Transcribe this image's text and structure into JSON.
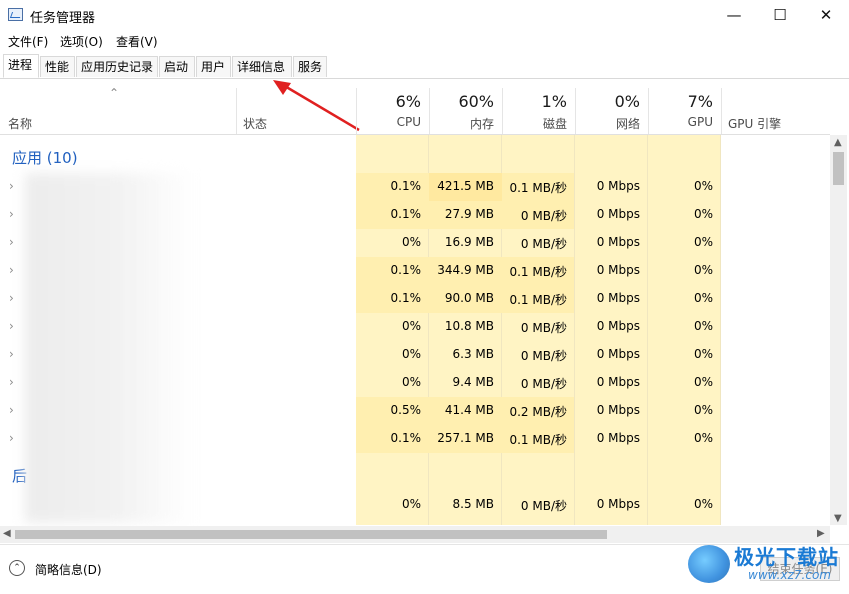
{
  "window": {
    "title": "任务管理器",
    "minimize": "—",
    "maximize": "☐",
    "close": "✕"
  },
  "menu": [
    "文件(F)",
    "选项(O)",
    "查看(V)"
  ],
  "tabs": [
    "进程",
    "性能",
    "应用历史记录",
    "启动",
    "用户",
    "详细信息",
    "服务"
  ],
  "columns": {
    "name": "名称",
    "status": "状态",
    "cpu": {
      "pct": "6%",
      "label": "CPU"
    },
    "memory": {
      "pct": "60%",
      "label": "内存"
    },
    "disk": {
      "pct": "1%",
      "label": "磁盘"
    },
    "network": {
      "pct": "0%",
      "label": "网络"
    },
    "gpu": {
      "pct": "7%",
      "label": "GPU"
    },
    "gpu_engine": "GPU 引擎"
  },
  "groups": {
    "apps": "应用 (10)",
    "background": "后"
  },
  "rows": [
    {
      "cpu": "0.1%",
      "mem": "421.5 MB",
      "disk": "0.1 MB/秒",
      "net": "0 Mbps",
      "gpu": "0%"
    },
    {
      "cpu": "0.1%",
      "mem": "27.9 MB",
      "disk": "0 MB/秒",
      "net": "0 Mbps",
      "gpu": "0%"
    },
    {
      "cpu": "0%",
      "mem": "16.9 MB",
      "disk": "0 MB/秒",
      "net": "0 Mbps",
      "gpu": "0%"
    },
    {
      "cpu": "0.1%",
      "mem": "344.9 MB",
      "disk": "0.1 MB/秒",
      "net": "0 Mbps",
      "gpu": "0%"
    },
    {
      "cpu": "0.1%",
      "mem": "90.0 MB",
      "disk": "0.1 MB/秒",
      "net": "0 Mbps",
      "gpu": "0%"
    },
    {
      "cpu": "0%",
      "mem": "10.8 MB",
      "disk": "0 MB/秒",
      "net": "0 Mbps",
      "gpu": "0%"
    },
    {
      "cpu": "0%",
      "mem": "6.3 MB",
      "disk": "0 MB/秒",
      "net": "0 Mbps",
      "gpu": "0%"
    },
    {
      "cpu": "0%",
      "mem": "9.4 MB",
      "disk": "0 MB/秒",
      "net": "0 Mbps",
      "gpu": "0%"
    },
    {
      "cpu": "0.5%",
      "mem": "41.4 MB",
      "disk": "0.2 MB/秒",
      "net": "0 Mbps",
      "gpu": "0%"
    },
    {
      "cpu": "0.1%",
      "mem": "257.1 MB",
      "disk": "0.1 MB/秒",
      "net": "0 Mbps",
      "gpu": "0%"
    }
  ],
  "bg_row": {
    "cpu": "0%",
    "mem": "8.5 MB",
    "disk": "0 MB/秒",
    "net": "0 Mbps",
    "gpu": "0%"
  },
  "footer": {
    "brief": "简略信息(D)",
    "end_task": "结束任务(E)"
  },
  "watermark": {
    "brand": "极光下载站",
    "url": "www.xz7.com"
  },
  "colors": {
    "highlight": "#fff4c4",
    "highlight_strong": "#ffe9a0",
    "group_title": "#1f5fbf",
    "arrow": "#e02020"
  }
}
